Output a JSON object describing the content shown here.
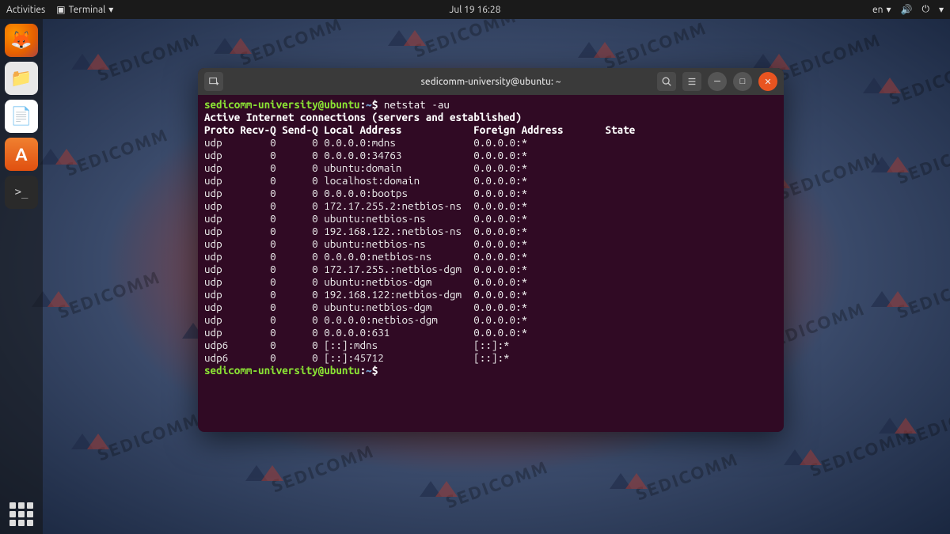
{
  "topbar": {
    "activities": "Activities",
    "terminal_menu": "Terminal",
    "datetime": "Jul 19  16:28",
    "lang": "en"
  },
  "dock": {
    "firefox_glyph": "🦊",
    "files_glyph": "📁",
    "office_glyph": "📄",
    "store_glyph": "A",
    "term_glyph": ">_"
  },
  "terminal": {
    "window_title": "sedicomm-university@ubuntu: ~",
    "prompt_user": "sedicomm-university@ubuntu",
    "prompt_sep": ":",
    "prompt_path": "~",
    "prompt_sigil": "$",
    "command": "netstat -au",
    "heading": "Active Internet connections (servers and established)",
    "columns": {
      "proto": "Proto",
      "recvq": "Recv-Q",
      "sendq": "Send-Q",
      "local": "Local Address",
      "foreign": "Foreign Address",
      "state": "State"
    },
    "rows": [
      {
        "proto": "udp",
        "recvq": "0",
        "sendq": "0",
        "local": "0.0.0.0:mdns",
        "foreign": "0.0.0.0:*",
        "state": ""
      },
      {
        "proto": "udp",
        "recvq": "0",
        "sendq": "0",
        "local": "0.0.0.0:34763",
        "foreign": "0.0.0.0:*",
        "state": ""
      },
      {
        "proto": "udp",
        "recvq": "0",
        "sendq": "0",
        "local": "ubuntu:domain",
        "foreign": "0.0.0.0:*",
        "state": ""
      },
      {
        "proto": "udp",
        "recvq": "0",
        "sendq": "0",
        "local": "localhost:domain",
        "foreign": "0.0.0.0:*",
        "state": ""
      },
      {
        "proto": "udp",
        "recvq": "0",
        "sendq": "0",
        "local": "0.0.0.0:bootps",
        "foreign": "0.0.0.0:*",
        "state": ""
      },
      {
        "proto": "udp",
        "recvq": "0",
        "sendq": "0",
        "local": "172.17.255.2:netbios-ns",
        "foreign": "0.0.0.0:*",
        "state": ""
      },
      {
        "proto": "udp",
        "recvq": "0",
        "sendq": "0",
        "local": "ubuntu:netbios-ns",
        "foreign": "0.0.0.0:*",
        "state": ""
      },
      {
        "proto": "udp",
        "recvq": "0",
        "sendq": "0",
        "local": "192.168.122.:netbios-ns",
        "foreign": "0.0.0.0:*",
        "state": ""
      },
      {
        "proto": "udp",
        "recvq": "0",
        "sendq": "0",
        "local": "ubuntu:netbios-ns",
        "foreign": "0.0.0.0:*",
        "state": ""
      },
      {
        "proto": "udp",
        "recvq": "0",
        "sendq": "0",
        "local": "0.0.0.0:netbios-ns",
        "foreign": "0.0.0.0:*",
        "state": ""
      },
      {
        "proto": "udp",
        "recvq": "0",
        "sendq": "0",
        "local": "172.17.255.:netbios-dgm",
        "foreign": "0.0.0.0:*",
        "state": ""
      },
      {
        "proto": "udp",
        "recvq": "0",
        "sendq": "0",
        "local": "ubuntu:netbios-dgm",
        "foreign": "0.0.0.0:*",
        "state": ""
      },
      {
        "proto": "udp",
        "recvq": "0",
        "sendq": "0",
        "local": "192.168.122:netbios-dgm",
        "foreign": "0.0.0.0:*",
        "state": ""
      },
      {
        "proto": "udp",
        "recvq": "0",
        "sendq": "0",
        "local": "ubuntu:netbios-dgm",
        "foreign": "0.0.0.0:*",
        "state": ""
      },
      {
        "proto": "udp",
        "recvq": "0",
        "sendq": "0",
        "local": "0.0.0.0:netbios-dgm",
        "foreign": "0.0.0.0:*",
        "state": ""
      },
      {
        "proto": "udp",
        "recvq": "0",
        "sendq": "0",
        "local": "0.0.0.0:631",
        "foreign": "0.0.0.0:*",
        "state": ""
      },
      {
        "proto": "udp6",
        "recvq": "0",
        "sendq": "0",
        "local": "[::]:mdns",
        "foreign": "[::]:*",
        "state": ""
      },
      {
        "proto": "udp6",
        "recvq": "0",
        "sendq": "0",
        "local": "[::]:45712",
        "foreign": "[::]:*",
        "state": ""
      }
    ]
  }
}
